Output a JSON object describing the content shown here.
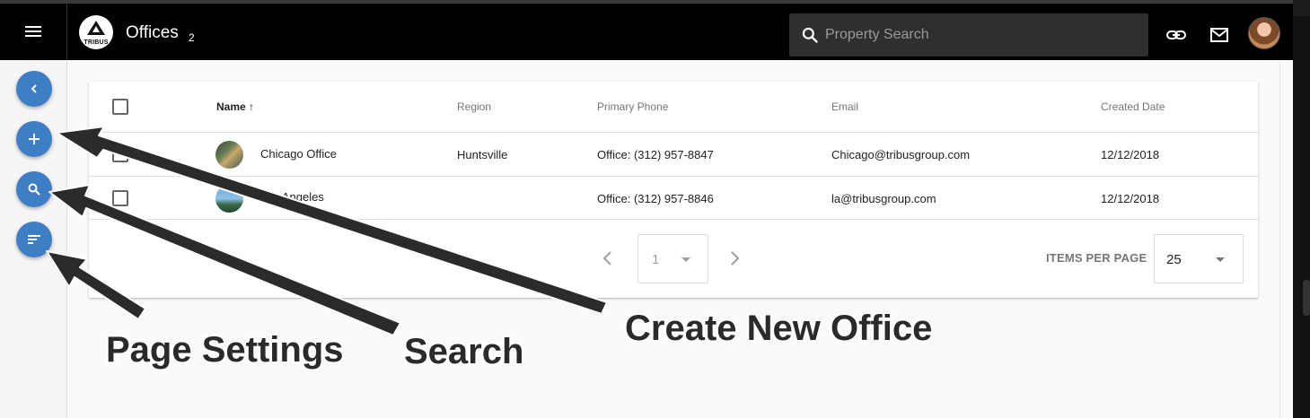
{
  "header": {
    "logo_text": "TRIBUS",
    "title": "Offices",
    "count": "2",
    "search_placeholder": "Property Search",
    "icons": [
      "menu-icon",
      "search-icon",
      "link-icon",
      "mail-icon",
      "avatar"
    ]
  },
  "rail": {
    "buttons": [
      "chevron-left-icon",
      "plus-icon",
      "search-icon",
      "sort-icon"
    ]
  },
  "table": {
    "columns": [
      "Name",
      "Region",
      "Primary Phone",
      "Email",
      "Created Date"
    ],
    "sort_indicator": "↑",
    "rows": [
      {
        "name": "Chicago Office",
        "region": "Huntsville",
        "phone": "Office: (312) 957-8847",
        "email": "Chicago@tribusgroup.com",
        "created": "12/12/2018"
      },
      {
        "name": "Los Angeles",
        "region": "",
        "phone": "Office: (312) 957-8846",
        "email": "la@tribusgroup.com",
        "created": "12/12/2018"
      }
    ]
  },
  "pager": {
    "page": "1",
    "items_per_page_label": "ITEMS PER PAGE",
    "items_per_page": "25"
  },
  "annotations": {
    "page_settings": "Page Settings",
    "search": "Search",
    "create_new_office": "Create New Office"
  },
  "colors": {
    "topbar": "#000000",
    "fab": "#3d7ec4",
    "annotation_text": "#2a2a2a"
  }
}
